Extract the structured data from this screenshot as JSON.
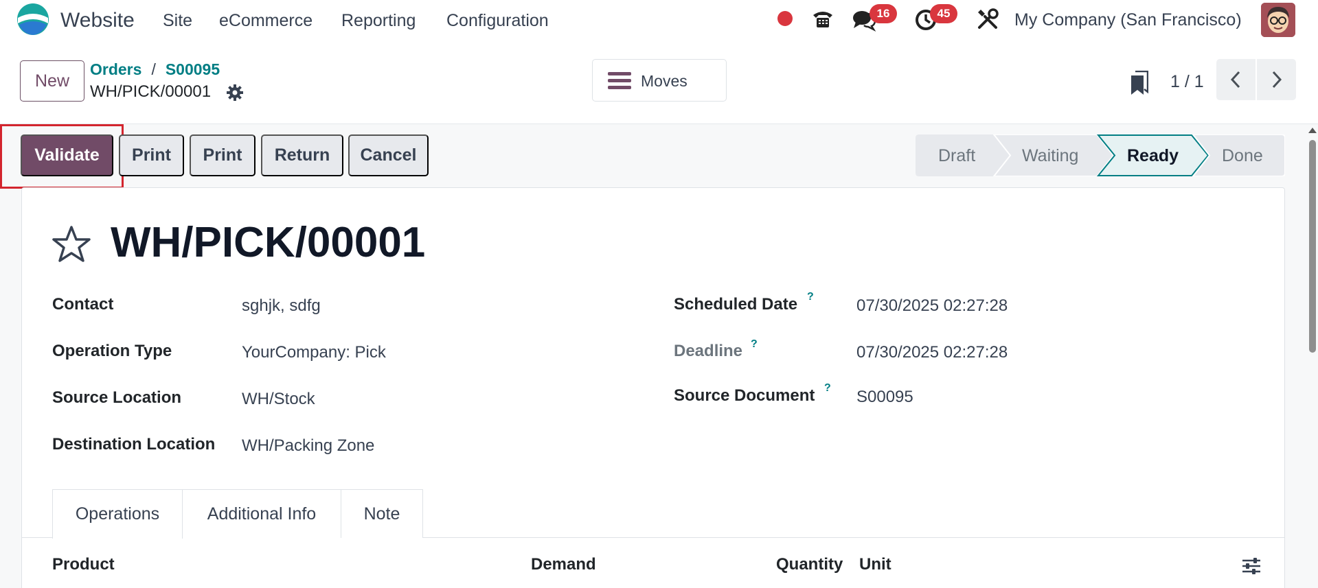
{
  "navbar": {
    "app_name": "Website",
    "menu": [
      "Site",
      "eCommerce",
      "Reporting",
      "Configuration"
    ],
    "chat_count": "16",
    "activity_count": "45",
    "company": "My Company (San Francisco)"
  },
  "control_panel": {
    "new_label": "New",
    "breadcrumb": [
      "Orders",
      "S00095"
    ],
    "breadcrumb_sep": "/",
    "record_name": "WH/PICK/00001",
    "moves_label": "Moves",
    "pager": "1 / 1"
  },
  "actions": {
    "validate": "Validate",
    "print1": "Print",
    "print2": "Print",
    "return": "Return",
    "cancel": "Cancel"
  },
  "status": {
    "stages": [
      "Draft",
      "Waiting",
      "Ready",
      "Done"
    ],
    "active": "Ready"
  },
  "form": {
    "title": "WH/PICK/00001",
    "left": [
      {
        "label": "Contact",
        "value": "sghjk, sdfg"
      },
      {
        "label": "Operation Type",
        "value": "YourCompany: Pick"
      },
      {
        "label": "Source Location",
        "value": "WH/Stock"
      },
      {
        "label": "Destination Location",
        "value": "WH/Packing Zone"
      }
    ],
    "right": [
      {
        "label": "Scheduled Date",
        "value": "07/30/2025 02:27:28"
      },
      {
        "label": "Deadline",
        "value": "07/30/2025 02:27:28"
      },
      {
        "label": "Source Document",
        "value": "S00095"
      }
    ],
    "help_mark": "?"
  },
  "tabs": [
    "Operations",
    "Additional Info",
    "Note"
  ],
  "table": {
    "columns": [
      "Product",
      "Demand",
      "Quantity",
      "Unit"
    ]
  },
  "colors": {
    "primary": "#714b67",
    "link": "#017e84",
    "badge": "#d9363e",
    "highlight": "#d3252e"
  }
}
